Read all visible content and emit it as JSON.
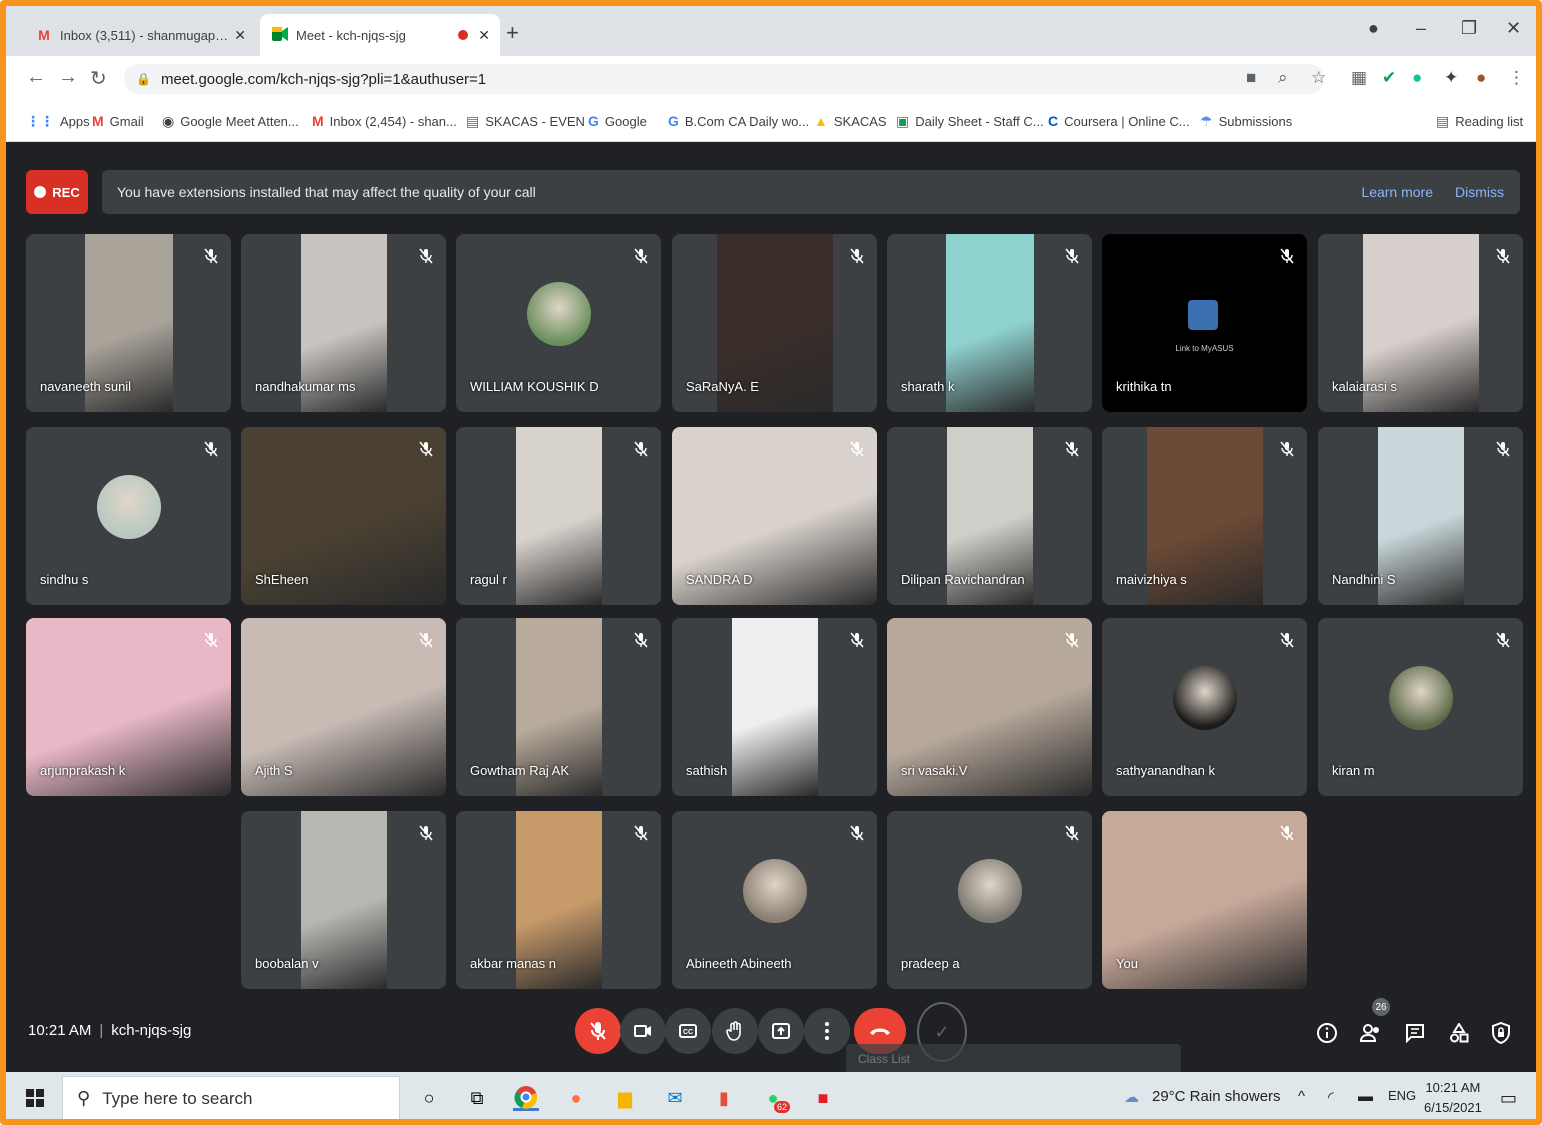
{
  "browser": {
    "tabs": [
      {
        "title": "Inbox (3,511) - shanmugapriyas",
        "icon": "gmail-icon"
      },
      {
        "title": "Meet - kch-njqs-sjg",
        "icon": "meet-icon"
      }
    ],
    "url": "meet.google.com/kch-njqs-sjg?pli=1&authuser=1",
    "bookmarks": [
      {
        "label": "Apps",
        "icon": "apps-grid-icon",
        "color": "#4285f4"
      },
      {
        "label": "Gmail",
        "icon": "gmail-icon",
        "color": "#ea4335"
      },
      {
        "label": "Google Meet Atten...",
        "icon": "meet-attendance-icon",
        "color": "#5f6368"
      },
      {
        "label": "Inbox (2,454) - shan...",
        "icon": "gmail-icon",
        "color": "#ea4335"
      },
      {
        "label": "SKACAS - EVEN",
        "icon": "classroom-icon",
        "color": "#3367d6"
      },
      {
        "label": "Google",
        "icon": "google-icon",
        "color": "#4285f4"
      },
      {
        "label": "B.Com CA Daily wo...",
        "icon": "google-icon",
        "color": "#4285f4"
      },
      {
        "label": "SKACAS",
        "icon": "drive-icon",
        "color": "#fbbc04"
      },
      {
        "label": "Daily Sheet - Staff C...",
        "icon": "sheets-icon",
        "color": "#0f9d58"
      },
      {
        "label": "Coursera | Online C...",
        "icon": "coursera-icon",
        "color": "#0056d2"
      },
      {
        "label": "Submissions",
        "icon": "submissions-icon",
        "color": "#8ab4f8"
      }
    ],
    "reading_list": "Reading list"
  },
  "meet": {
    "rec_label": "REC",
    "notice": "You have extensions installed that may affect the quality of your call",
    "learn_more": "Learn more",
    "dismiss": "Dismiss",
    "time": "10:21 AM",
    "meeting_code": "kch-njqs-sjg",
    "participant_count": "26",
    "class_list": "Class List",
    "colors": {
      "end_call": "#ea4335",
      "tile": "#3c4043",
      "background": "#202124"
    },
    "participants": [
      {
        "name": "navaneeth sunil",
        "kind": "video",
        "color": "#a9a39a",
        "avatar_color": ""
      },
      {
        "name": "nandhakumar ms",
        "kind": "video",
        "color": "#c8c4c0",
        "avatar_color": ""
      },
      {
        "name": "WILLIAM KOUSHIK D",
        "kind": "avatar",
        "color": "",
        "avatar_color": "#6b8f5e"
      },
      {
        "name": "SaRaNyA. E",
        "kind": "video",
        "color": "#3a2e2a",
        "avatar_color": ""
      },
      {
        "name": "sharath k",
        "kind": "video",
        "color": "#8fd1cf",
        "avatar_color": ""
      },
      {
        "name": "krithika tn",
        "kind": "screen",
        "color": "#000000",
        "avatar_color": "",
        "screen_text": "Link to MyASUS"
      },
      {
        "name": "kalaiarasi s",
        "kind": "video",
        "color": "#d7cfcb",
        "avatar_color": ""
      },
      {
        "name": "sindhu s",
        "kind": "avatar",
        "color": "",
        "avatar_color": "#b7c9c2"
      },
      {
        "name": "ShEheen",
        "kind": "video",
        "color": "#4a4132",
        "avatar_color": ""
      },
      {
        "name": "ragul r",
        "kind": "video",
        "color": "#d8d2cd",
        "avatar_color": ""
      },
      {
        "name": "SANDRA D",
        "kind": "video",
        "color": "#d9d2cc",
        "avatar_color": ""
      },
      {
        "name": "Dilipan Ravichandran",
        "kind": "video",
        "color": "#cfcfca",
        "avatar_color": ""
      },
      {
        "name": "maivizhiya s",
        "kind": "video",
        "color": "#6d4a35",
        "avatar_color": ""
      },
      {
        "name": "Nandhini S",
        "kind": "video",
        "color": "#c9d7da",
        "avatar_color": ""
      },
      {
        "name": "arjunprakash k",
        "kind": "video",
        "color": "#e9b8c6",
        "avatar_color": ""
      },
      {
        "name": "Ajith S",
        "kind": "video",
        "color": "#c7bbb4",
        "avatar_color": ""
      },
      {
        "name": "Gowtham Raj AK",
        "kind": "video",
        "color": "#b8ab9c",
        "avatar_color": ""
      },
      {
        "name": "sathish",
        "kind": "video",
        "color": "#eeeeee",
        "avatar_color": ""
      },
      {
        "name": "sri vasaki.V",
        "kind": "video",
        "color": "#b6a89b",
        "avatar_color": ""
      },
      {
        "name": "sathyanandhan k",
        "kind": "avatar",
        "color": "",
        "avatar_color": "#1a1a1a"
      },
      {
        "name": "kiran m",
        "kind": "avatar",
        "color": "",
        "avatar_color": "#5c6a48"
      },
      {
        "name": "boobalan v",
        "kind": "video",
        "color": "#b9b7b3",
        "avatar_color": ""
      },
      {
        "name": "akbar manas n",
        "kind": "video",
        "color": "#c79a6a",
        "avatar_color": ""
      },
      {
        "name": "Abineeth Abineeth",
        "kind": "avatar",
        "color": "",
        "avatar_color": "#8a7f72"
      },
      {
        "name": "pradeep a",
        "kind": "avatar",
        "color": "",
        "avatar_color": "#7d7a72"
      },
      {
        "name": "You",
        "kind": "video",
        "color": "#c7a99a",
        "avatar_color": ""
      }
    ]
  },
  "taskbar": {
    "search_placeholder": "Type here to search",
    "weather": "29°C  Rain showers",
    "language": "ENG",
    "time": "10:21 AM",
    "date": "6/15/2021",
    "whatsapp_badge": "62"
  }
}
